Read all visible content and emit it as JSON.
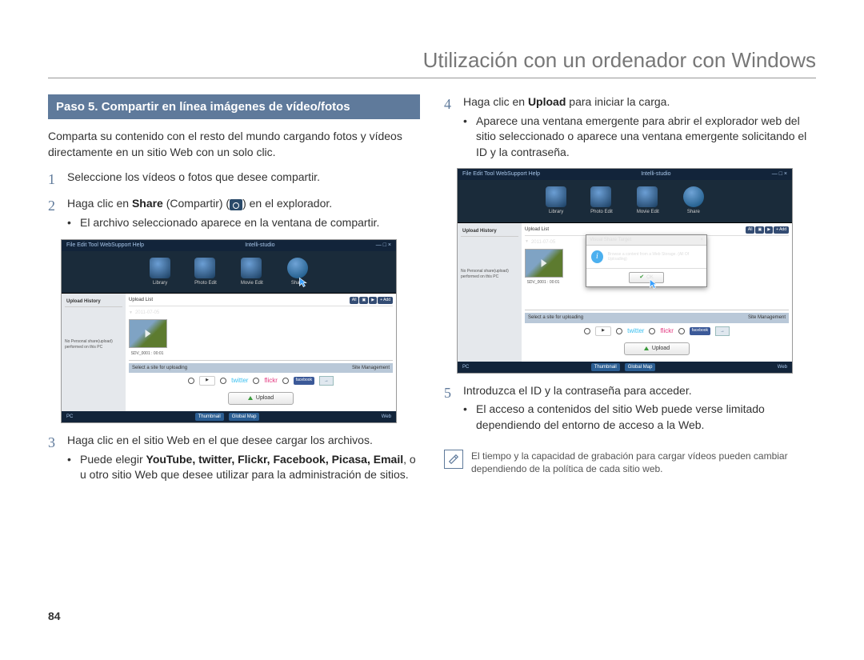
{
  "header": {
    "title": "Utilización con un ordenador con Windows"
  },
  "left": {
    "step_header": "Paso 5. Compartir en línea imágenes de vídeo/fotos",
    "intro": "Comparta su contenido con el resto del mundo cargando fotos y vídeos directamente en un sitio Web con un solo clic.",
    "n1": "1",
    "s1": "Seleccione los vídeos o fotos que desee compartir.",
    "n2": "2",
    "s2_pre": "Haga clic en ",
    "s2_bold": "Share",
    "s2_mid": " (Compartir) (",
    "s2_post": ") en el explorador.",
    "s2_b1": "El archivo seleccionado aparece en la ventana de compartir.",
    "n3": "3",
    "s3": "Haga clic en el sitio Web en el que desee cargar los archivos.",
    "s3_b1_pre": "Puede elegir ",
    "s3_b1_bold": "YouTube, twitter, Flickr, Facebook, Picasa, Email",
    "s3_b1_post": ", o u otro sitio Web que desee utilizar para la administración de sitios."
  },
  "right": {
    "n4": "4",
    "s4_pre": "Haga clic en ",
    "s4_bold": "Upload",
    "s4_post": " para iniciar la carga.",
    "s4_b1": "Aparece una ventana emergente para abrir el explorador web del sitio seleccionado o aparece una ventana emergente solicitando el ID y la contraseña.",
    "n5": "5",
    "s5": "Introduzca el ID y la contraseña para acceder.",
    "s5_b1": "El acceso a contenidos del sitio Web puede verse limitado dependiendo del entorno de acceso a la Web.",
    "note": "El tiempo y la capacidad de grabación para cargar vídeos pueden cambiar dependiendo de la política de cada sitio web."
  },
  "app": {
    "brand": "Intelli-studio",
    "menu": "File  Edit  Tool  WebSupport  Help",
    "window_close": "— □ ×",
    "tabs": {
      "library": "Library",
      "photo": "Photo Edit",
      "movie": "Movie Edit",
      "share": "Share"
    },
    "sidebar": {
      "history": "Upload History",
      "note": "No Personal share(upload) performed on this PC"
    },
    "main": {
      "list": "Upload List",
      "add": "+ Add",
      "date": "2011-07-05",
      "clip": "SDV_0001 : 00:01",
      "caption": "Select a site for uploading",
      "mgmt": "Site Management",
      "upload": "Upload"
    },
    "filters": {
      "all": "All",
      "p": "▣",
      "v": "▶"
    },
    "sites": {
      "yt": "YouTube",
      "tw": "twitter",
      "fl": "flickr",
      "fb": "facebook"
    },
    "footer": {
      "pc": "PC",
      "thumb": "Thumbnail",
      "map": "Global Map",
      "web": "Web"
    },
    "dialog": {
      "title": "Visual Share Target",
      "close": "×",
      "msg": "Browse a content from a Web Storage. (All Of Uploading)",
      "ok": "OK"
    }
  },
  "page_number": "84"
}
